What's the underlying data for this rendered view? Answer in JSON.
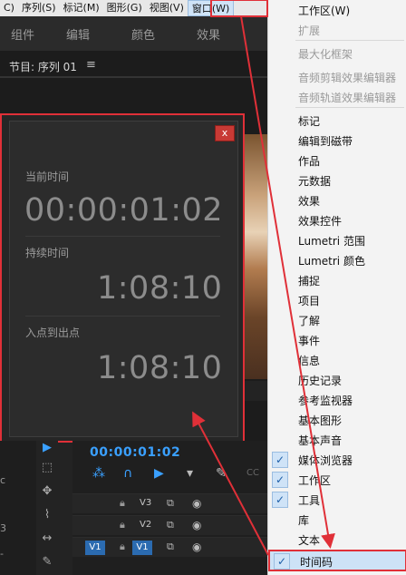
{
  "menubar": {
    "items": [
      "C)",
      "序列(S)",
      "标记(M)",
      "图形(G)",
      "视图(V)",
      "窗口(W)"
    ]
  },
  "workspace_tabs": [
    "组件",
    "编辑",
    "颜色",
    "效果"
  ],
  "program_monitor": {
    "title": "节目: 序列 01",
    "menu_glyph": "≡"
  },
  "timecode_panel": {
    "close": "x",
    "current_time_label": "当前时间",
    "current_time": "00:00:01:02",
    "duration_label": "持续时间",
    "duration": "1:08:10",
    "in_out_label": "入点到出点",
    "in_out": "1:08:10"
  },
  "left_edge": [
    "c",
    "3",
    "-"
  ],
  "timeline": {
    "timecode": "00:00:01:02",
    "tracks": [
      {
        "name": "V3"
      },
      {
        "name": "V2"
      },
      {
        "name": "V1",
        "src": "V1"
      }
    ]
  },
  "window_menu": {
    "items": [
      {
        "label": "工作区(W)",
        "enabled": true,
        "checked": false
      },
      {
        "label": "扩展",
        "enabled": false,
        "checked": false
      },
      {
        "label": "最大化框架",
        "enabled": false,
        "checked": false
      },
      {
        "label": "音频剪辑效果编辑器",
        "enabled": false,
        "checked": false
      },
      {
        "label": "音频轨道效果编辑器",
        "enabled": false,
        "checked": false
      },
      {
        "label": "标记",
        "enabled": true,
        "checked": false
      },
      {
        "label": "编辑到磁带",
        "enabled": true,
        "checked": false
      },
      {
        "label": "作品",
        "enabled": true,
        "checked": false
      },
      {
        "label": "元数据",
        "enabled": true,
        "checked": false
      },
      {
        "label": "效果",
        "enabled": true,
        "checked": false
      },
      {
        "label": "效果控件",
        "enabled": true,
        "checked": false
      },
      {
        "label": "Lumetri 范围",
        "enabled": true,
        "checked": false
      },
      {
        "label": "Lumetri 颜色",
        "enabled": true,
        "checked": false
      },
      {
        "label": "捕捉",
        "enabled": true,
        "checked": false
      },
      {
        "label": "项目",
        "enabled": true,
        "checked": false
      },
      {
        "label": "了解",
        "enabled": true,
        "checked": false
      },
      {
        "label": "事件",
        "enabled": true,
        "checked": false
      },
      {
        "label": "信息",
        "enabled": true,
        "checked": false
      },
      {
        "label": "历史记录",
        "enabled": true,
        "checked": false
      },
      {
        "label": "参考监视器",
        "enabled": true,
        "checked": false
      },
      {
        "label": "基本图形",
        "enabled": true,
        "checked": false
      },
      {
        "label": "基本声音",
        "enabled": true,
        "checked": false
      },
      {
        "label": "媒体浏览器",
        "enabled": true,
        "checked": true
      },
      {
        "label": "工作区",
        "enabled": true,
        "checked": true
      },
      {
        "label": "工具",
        "enabled": true,
        "checked": true
      },
      {
        "label": "库",
        "enabled": true,
        "checked": false
      },
      {
        "label": "文本",
        "enabled": true,
        "checked": false
      },
      {
        "label": "时间码",
        "enabled": true,
        "checked": true
      }
    ]
  },
  "colors": {
    "accent_blue": "#3aa0ff",
    "highlight_red": "#e03038",
    "menu_bg": "#f3f3f3"
  }
}
